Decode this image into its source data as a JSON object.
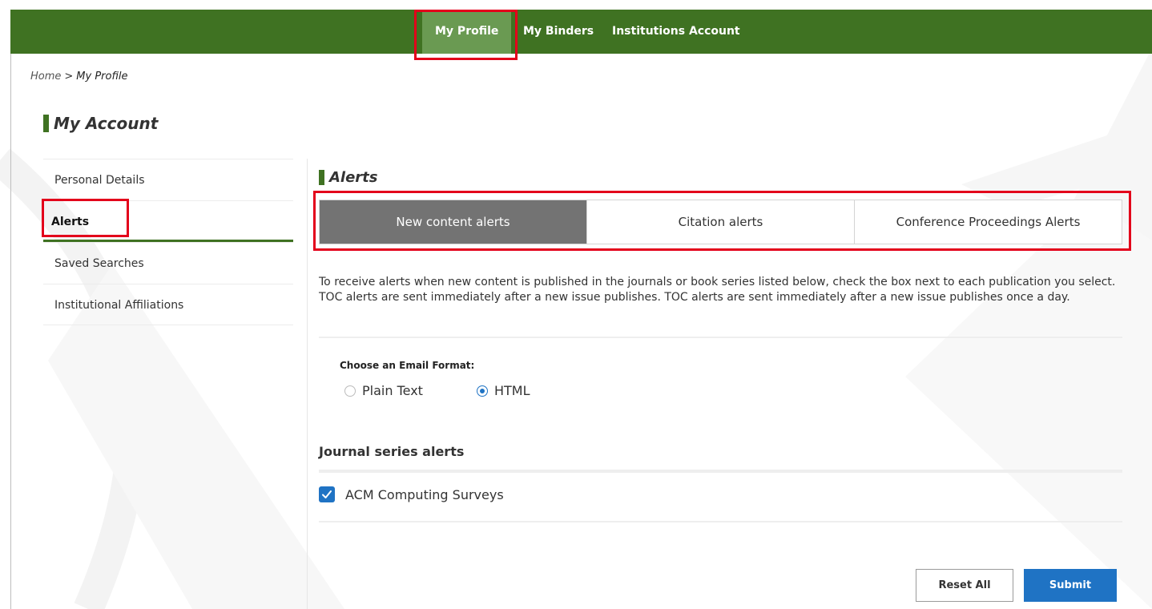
{
  "nav": {
    "items": [
      {
        "label": "My Profile",
        "active": true
      },
      {
        "label": "My Binders",
        "active": false
      },
      {
        "label": "Institutions Account",
        "active": false
      }
    ]
  },
  "breadcrumb": {
    "home": "Home",
    "separator": ">",
    "current": "My Profile"
  },
  "account_title": "My Account",
  "sidebar": {
    "items": [
      {
        "label": "Personal Details",
        "active": false
      },
      {
        "label": "Alerts",
        "active": true
      },
      {
        "label": "Saved Searches",
        "active": false
      },
      {
        "label": "Institutional Affiliations",
        "active": false
      }
    ]
  },
  "alerts": {
    "title": "Alerts",
    "tabs": [
      {
        "label": "New content alerts",
        "active": true
      },
      {
        "label": "Citation alerts",
        "active": false
      },
      {
        "label": "Conference Proceedings Alerts",
        "active": false
      }
    ],
    "description": "To receive alerts when new content is published in the journals or book series listed below, check the box next to each publication you select. TOC alerts are sent immediately after a new issue publishes. TOC alerts are sent immediately after a new issue publishes once a day.",
    "email_format": {
      "label": "Choose an Email Format:",
      "options": [
        {
          "label": "Plain Text",
          "selected": false
        },
        {
          "label": "HTML",
          "selected": true
        }
      ]
    },
    "series_heading": "Journal series alerts",
    "journals": [
      {
        "label": "ACM Computing Surveys",
        "checked": true
      }
    ],
    "buttons": {
      "reset": "Reset All",
      "submit": "Submit"
    }
  },
  "colors": {
    "nav_bg": "#3f7222",
    "accent_green": "#3f7222",
    "active_tab": "#737373",
    "primary_blue": "#1f73c4",
    "highlight_red": "#e3001b"
  }
}
